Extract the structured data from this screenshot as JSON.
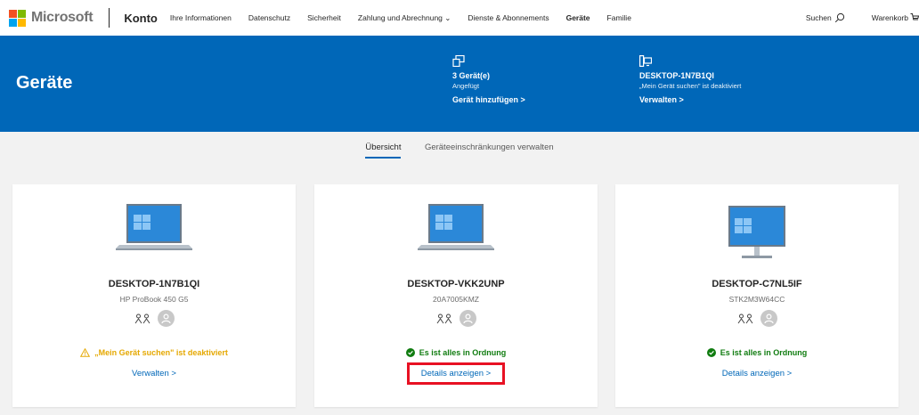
{
  "header": {
    "brand": "Microsoft",
    "section": "Konto",
    "nav": [
      "Ihre Informationen",
      "Datenschutz",
      "Sicherheit",
      "Zahlung und Abrechnung ⌄",
      "Dienste & Abonnements",
      "Geräte",
      "Familie"
    ],
    "active_nav": "Geräte",
    "search_label": "Suchen",
    "cart_label": "Warenkorb"
  },
  "hero": {
    "title": "Geräte",
    "block1": {
      "icon": "devices-icon",
      "heading": "3 Gerät(e)",
      "sub": "Angefügt",
      "link": "Gerät hinzufügen >"
    },
    "block2": {
      "icon": "computer-icon",
      "heading": "DESKTOP-1N7B1QI",
      "sub": "„Mein Gerät suchen\" ist deaktiviert",
      "link": "Verwalten >"
    }
  },
  "tabs": [
    {
      "label": "Übersicht",
      "active": true
    },
    {
      "label": "Geräteeinschränkungen verwalten",
      "active": false
    }
  ],
  "devices": [
    {
      "name": "DESKTOP-1N7B1QI",
      "model": "HP ProBook 450 G5",
      "type": "laptop",
      "status": "„Mein Gerät suchen\" ist deaktiviert",
      "status_kind": "warning",
      "link": "Verwalten >"
    },
    {
      "name": "DESKTOP-VKK2UNP",
      "model": "20A7005KMZ",
      "type": "laptop",
      "status": "Es ist alles in Ordnung",
      "status_kind": "ok",
      "link": "Details anzeigen >"
    },
    {
      "name": "DESKTOP-C7NL5IF",
      "model": "STK2M3W64CC",
      "type": "desktop",
      "status": "Es ist alles in Ordnung",
      "status_kind": "ok",
      "link": "Details anzeigen >"
    }
  ],
  "colors": {
    "brand_blue": "#0067b8",
    "warning": "#e5a800",
    "ok": "#107c10",
    "highlight": "#e81123"
  }
}
